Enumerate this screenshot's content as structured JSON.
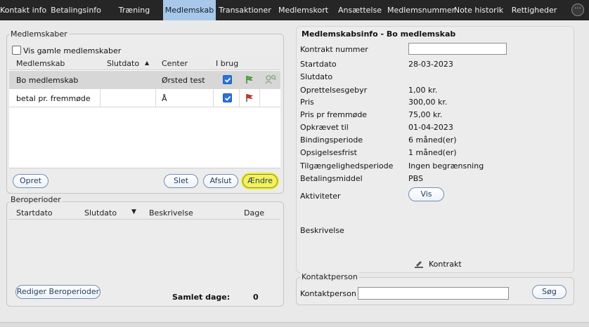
{
  "tabs": [
    {
      "label": "Kontakt info",
      "active": false
    },
    {
      "label": "Betalingsinfo",
      "active": false
    },
    {
      "label": "Træning",
      "active": false
    },
    {
      "label": "Medlemskab",
      "active": true
    },
    {
      "label": "Transaktioner",
      "active": false
    },
    {
      "label": "Medlemskort",
      "active": false
    },
    {
      "label": "Ansættelse",
      "active": false
    },
    {
      "label": "Medlemsnummer",
      "active": false
    },
    {
      "label": "Note historik",
      "active": false
    },
    {
      "label": "Rettigheder",
      "active": false
    }
  ],
  "memberships": {
    "title": "Medlemskaber",
    "show_old_label": "Vis gamle medlemskaber",
    "show_old_checked": false,
    "columns": [
      "Medlemskab",
      "Slutdato",
      "Center",
      "I brug"
    ],
    "rows": [
      {
        "name": "Bo medlemskab",
        "enddate": "",
        "center": "Ørsted test",
        "in_use": true,
        "selected": true
      },
      {
        "name": "betal pr. fremmøde",
        "enddate": "",
        "center": "Å",
        "in_use": true,
        "selected": false
      }
    ],
    "buttons": {
      "create": "Opret",
      "delete": "Slet",
      "end": "Afslut",
      "change": "Ændre"
    }
  },
  "pauses": {
    "title": "Beroperioder",
    "columns": [
      "Startdato",
      "Slutdato",
      "Beskrivelse",
      "Dage"
    ],
    "edit_button": "Rediger Beroperioder",
    "total_label": "Samlet dage:",
    "total_value": "0"
  },
  "info": {
    "title": "Medlemskabsinfo - Bo medlemskab",
    "fields": [
      {
        "label": "Kontrakt nummer",
        "value": ""
      },
      {
        "label": "Startdato",
        "value": "28-03-2023"
      },
      {
        "label": "Slutdato",
        "value": ""
      },
      {
        "label": "Oprettelsesgebyr",
        "value": "1,00 kr."
      },
      {
        "label": "Pris",
        "value": "300,00 kr."
      },
      {
        "label": "Pris pr fremmøde",
        "value": "75,00 kr."
      },
      {
        "label": "Opkrævet til",
        "value": "01-04-2023"
      },
      {
        "label": "Bindingsperiode",
        "value": "6 måned(er)"
      },
      {
        "label": "Opsigelsesfrist",
        "value": "1 måned(er)"
      },
      {
        "label": "Tilgængelighedsperiode",
        "value": "Ingen begrænsning"
      },
      {
        "label": "Betalingsmiddel",
        "value": "PBS"
      }
    ],
    "activities_label": "Aktiviteter",
    "show_button": "Vis",
    "description_label": "Beskrivelse",
    "contract_link": "Kontrakt"
  },
  "contact": {
    "title": "Kontaktperson",
    "label": "Kontaktperson",
    "value": "",
    "search_button": "Søg"
  },
  "colors": {
    "tabbar": "#262626",
    "active_tab": "#a7c8e8",
    "highlight": "#f4f25a",
    "check": "#2b73d8"
  }
}
